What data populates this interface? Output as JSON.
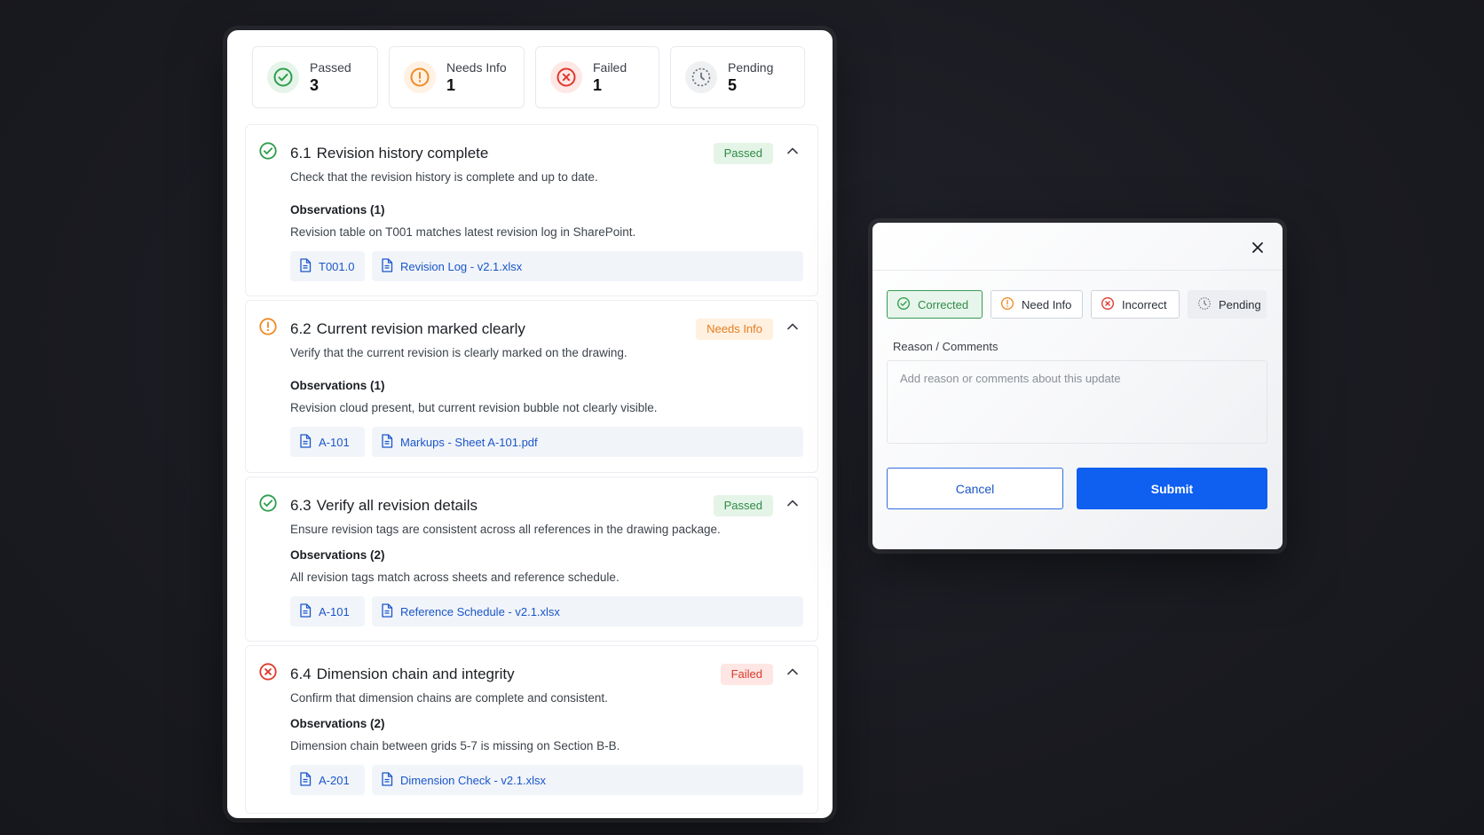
{
  "summary": [
    {
      "label": "Passed",
      "count": "3",
      "status": "pass"
    },
    {
      "label": "Needs Info",
      "count": "1",
      "status": "info"
    },
    {
      "label": "Failed",
      "count": "1",
      "status": "fail"
    },
    {
      "label": "Pending",
      "count": "5",
      "status": "pending"
    }
  ],
  "items": [
    {
      "number": "6.1",
      "title": "Revision history complete",
      "badge": "Passed",
      "status": "pass",
      "description": "Check that the revision history is complete and up to date.",
      "observations_title": "Observations (1)",
      "observation": "Revision table on T001 matches latest revision log in SharePoint.",
      "attachments": [
        "T001.0",
        "Revision Log - v2.1.xlsx"
      ]
    },
    {
      "number": "6.2",
      "title": "Current revision marked clearly",
      "badge": "Needs Info",
      "status": "info",
      "description": "Verify that the current revision is clearly marked on the drawing.",
      "observations_title": "Observations (1)",
      "observation": "Revision cloud present, but current revision bubble not clearly visible.",
      "attachments": [
        "A-101",
        "Markups - Sheet A-101.pdf"
      ]
    },
    {
      "number": "6.3",
      "title": "Verify all revision details",
      "badge": "Passed",
      "status": "pass",
      "description": "Ensure revision tags are consistent across all references in the drawing package.",
      "observations_title": "Observations (2)",
      "observation": "All revision tags match across sheets and reference schedule.",
      "attachments": [
        "A-101",
        "Reference Schedule - v2.1.xlsx"
      ]
    },
    {
      "number": "6.4",
      "title": "Dimension chain and integrity",
      "badge": "Failed",
      "status": "fail",
      "description": "Confirm that dimension chains are complete and consistent.",
      "observations_title": "Observations (2)",
      "observation": "Dimension chain between grids 5-7 is missing on Section B-B.",
      "attachments": [
        "A-201",
        "Dimension Check - v2.1.xlsx"
      ]
    }
  ],
  "modal": {
    "options": [
      {
        "label": "Corrected",
        "icon": "check-circle-icon",
        "selected": true
      },
      {
        "label": "Need Info",
        "icon": "alert-circle-icon",
        "selected": false
      },
      {
        "label": "Incorrect",
        "icon": "x-circle-icon",
        "selected": false
      },
      {
        "label": "Pending",
        "icon": "clock-icon",
        "selected": false
      }
    ],
    "field_label": "Reason / Comments",
    "placeholder": "Add reason or comments about this update",
    "cancel_label": "Cancel",
    "submit_label": "Submit"
  },
  "colors": {
    "pass": "#2e9e4a",
    "info": "#f08a24",
    "fail": "#e0392d",
    "pending": "#6b7079",
    "primary": "#0f5ff0",
    "link": "#1a56c9"
  }
}
